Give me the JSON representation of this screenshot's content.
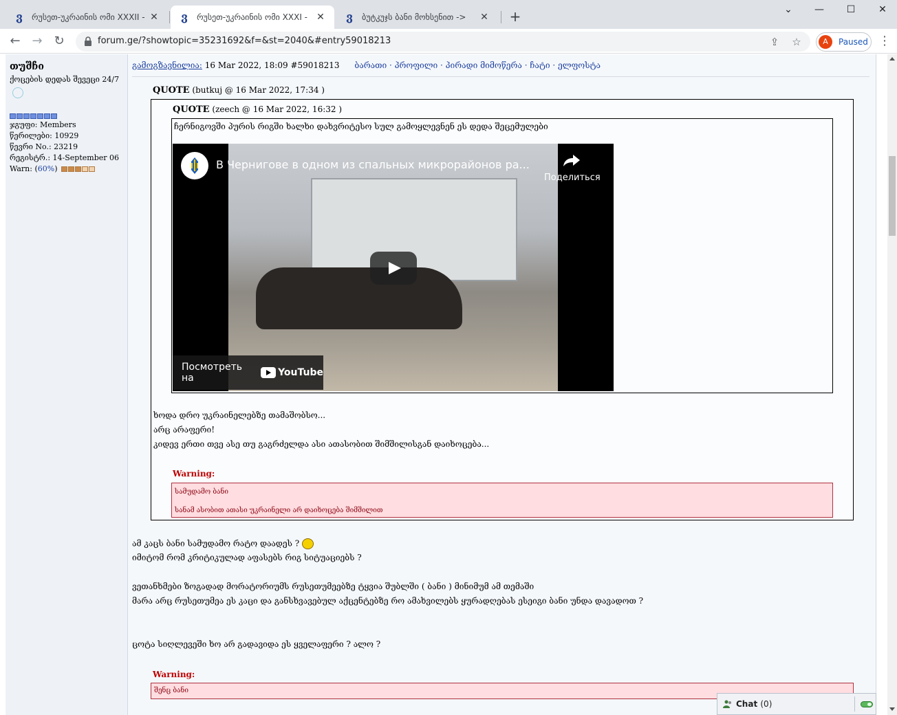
{
  "browser": {
    "tabs": [
      {
        "title": "რუსეთ-უკრაინის ომი XXXII -",
        "active": false
      },
      {
        "title": "რუსეთ-უკრაინის ომი XXXI - ",
        "active": true
      },
      {
        "title": "ბუტკუჯს ბანი მოხსენით -> ",
        "active": false
      }
    ],
    "favicon_glyph": "ვ",
    "new_tab": "+",
    "url": "forum.ge/?showtopic=35231692&f=&st=2040&#entry59018213",
    "profile_initial": "A",
    "profile_status": "Paused"
  },
  "user": {
    "name": "თუშჩი",
    "title": "ქოცების დედას შევეცი 24/7",
    "group_label": "ჯგუფი:",
    "group": "Members",
    "posts_label": "წერილები:",
    "posts": "10929",
    "member_no_label": "წევრი No.:",
    "member_no": "23219",
    "joined_label": "რეგისტრ.:",
    "joined": "14-September 06",
    "warn_label": "Warn:",
    "warn_pct": "60%",
    "warn_level": 0.6
  },
  "post": {
    "posted_label": "გამოგზავნილია:",
    "date": "16 Mar 2022, 18:09",
    "entry": "#59018213",
    "links": "ბარათი · პროფილი · პირადი მიმოწერა · ჩატი · ელფოსტა",
    "quote1_label": "QUOTE",
    "quote1_meta": "(butkuj @ 16 Mar 2022, 17:34 )",
    "quote2_label": "QUOTE",
    "quote2_meta": "(zeech @ 16 Mar 2022, 16:32 )",
    "quote2_text": "ჩერნიგოვში პურის რიგში ხალხი დახვრიტესო სულ გამოყლევნენ ეს დედა შეცემულები",
    "video": {
      "title": "В Чернигове в одном из спальных микрорайонов ра...",
      "share": "Поделиться",
      "watch_on": "Посмотреть на",
      "yt_brand": "YouTube"
    },
    "quote1_lines": [
      "ხოდა დრო უკრაინელებზე თამაშობსო...",
      "არც არაფერი!",
      "კიდევ ერთი თვე ასე თუ გაგრძელდა ასი ათასობით შიმშილისგან დაიხოცება..."
    ],
    "warning1_label": "Warning:",
    "warning1_lines": [
      "სამუდამო ბანი",
      "სანამ ასობით ათასი უკრაინელი არ დაიხოცება შიმშილით"
    ],
    "body_lines": [
      "ამ კაცს ბანი სამუდამო რატო დაადეს ?",
      "იმიტომ რომ კრიტიკულად აფასებს რიგ სიტუაციებს ?",
      "ვეთანხმები ზოგადად მორატორიუმს რუსეთუმეებზე ტყვია შუბლში ( ბანი ) მინიმუმ ამ თემაში",
      "მარა არც რუსეთუმეა ეს კაცი და განსხვავებულ აქცენტებზე რო ამახვილებს ყურადღებას ესეიგი ბანი უნდა დავადოთ ?",
      "ცოტა სიღლევეში ხო არ გადავიდა ეს ყველაფერი ? ალო ?"
    ],
    "warning2_label": "Warning:",
    "warning2_text": "შენც ბანი"
  },
  "chat": {
    "label": "Chat",
    "count": "(0)"
  },
  "colors": {
    "link": "#1c3f9e",
    "warning": "#c00000",
    "warn_bg": "#ffdde0"
  }
}
